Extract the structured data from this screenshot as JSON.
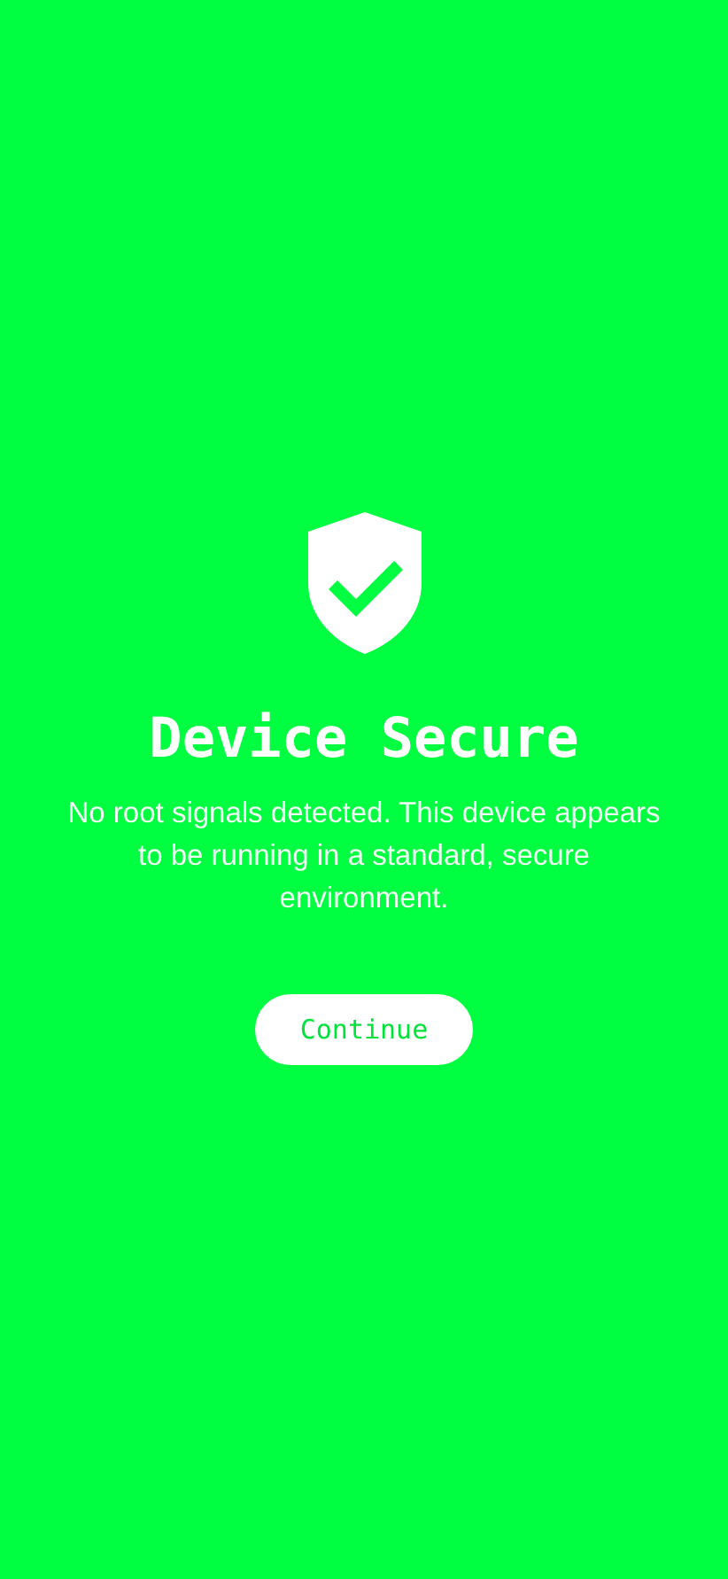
{
  "title": "Device Secure",
  "message": "No root signals detected. This device appears to be running in a standard, secure environment.",
  "button": {
    "label": "Continue"
  }
}
